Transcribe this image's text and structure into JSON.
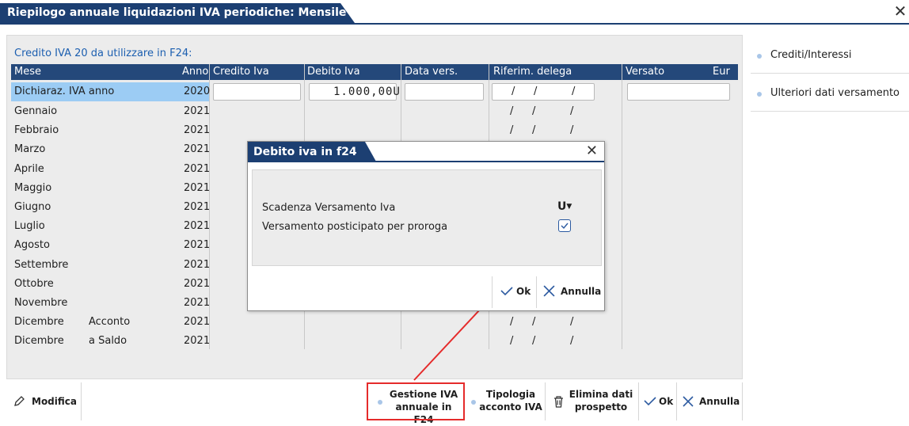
{
  "window": {
    "title": "Riepilogo annuale liquidazioni IVA periodiche: Mensile"
  },
  "credit_title": "Credito IVA 20 da utilizzare in F24:",
  "columns": [
    "Mese",
    "Anno",
    "Credito Iva",
    "Debito Iva",
    "Data vers.",
    "Riferim. delega",
    "Versato",
    "Eur"
  ],
  "first_row": {
    "mese": "Dichiaraz. IVA anno",
    "anno": "2020",
    "debito": "1.000,00U"
  },
  "rows": [
    {
      "mese": "Gennaio",
      "sub": "",
      "anno": "2021"
    },
    {
      "mese": "Febbraio",
      "sub": "",
      "anno": "2021"
    },
    {
      "mese": "Marzo",
      "sub": "",
      "anno": "2021"
    },
    {
      "mese": "Aprile",
      "sub": "",
      "anno": "2021"
    },
    {
      "mese": "Maggio",
      "sub": "",
      "anno": "2021"
    },
    {
      "mese": "Giugno",
      "sub": "",
      "anno": "2021"
    },
    {
      "mese": "Luglio",
      "sub": "",
      "anno": "2021"
    },
    {
      "mese": "Agosto",
      "sub": "",
      "anno": "2021"
    },
    {
      "mese": "Settembre",
      "sub": "",
      "anno": "2021"
    },
    {
      "mese": "Ottobre",
      "sub": "",
      "anno": "2021"
    },
    {
      "mese": "Novembre",
      "sub": "",
      "anno": "2021"
    },
    {
      "mese": "Dicembre",
      "sub": "Acconto",
      "anno": "2021"
    },
    {
      "mese": "Dicembre",
      "sub": "a Saldo",
      "anno": "2021"
    }
  ],
  "riferim_separator": "/",
  "side": {
    "crediti": "Crediti/Interessi",
    "ulteriori": "Ulteriori dati versamento"
  },
  "dialog": {
    "title": "Debito iva in f24",
    "scadenza_label": "Scadenza Versamento Iva",
    "scadenza_value": "U",
    "posticipato_label": "Versamento posticipato per proroga",
    "posticipato_checked": true,
    "ok": "Ok",
    "annulla": "Annulla"
  },
  "toolbar": {
    "modifica": "Modifica",
    "gestione_1": "Gestione IVA",
    "gestione_2": "annuale in F24",
    "tipologia_1": "Tipologia",
    "tipologia_2": "acconto IVA",
    "elimina_1": "Elimina dati",
    "elimina_2": "prospetto",
    "ok": "Ok",
    "annulla": "Annulla"
  },
  "colors": {
    "title_bg": "#1c3f72",
    "header_bg": "#24487a",
    "selected_row": "#9cccf4",
    "highlight": "#e52b2b",
    "link_blue": "#1c5fb0"
  }
}
